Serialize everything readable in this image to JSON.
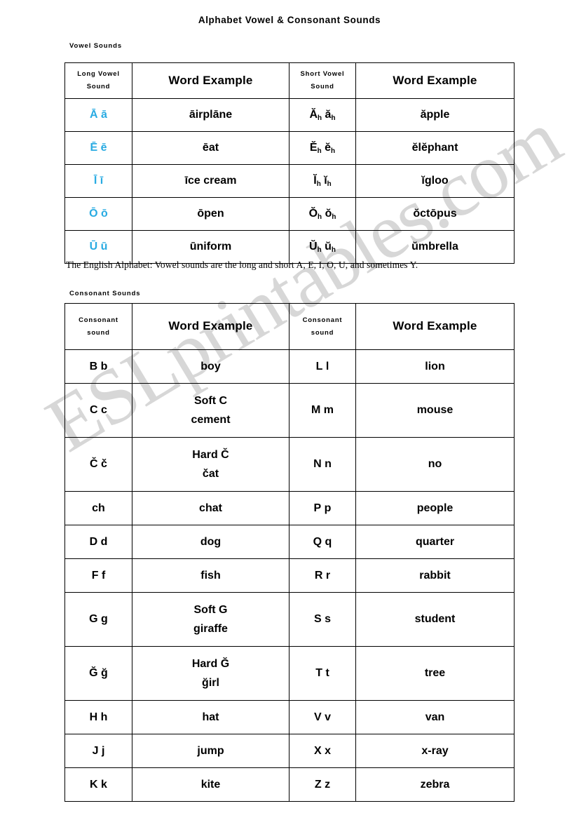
{
  "document": {
    "title": "Alphabet Vowel & Consonant Sounds",
    "watermark": "ESLprintables.com",
    "caption": "The English Alphabet: Vowel sounds are the long and short A, E, I, O, U, and sometimes Y."
  },
  "colors": {
    "long_vowel": "#29abe2",
    "short_vowel": "#7b6b9e",
    "navy": "#1b2b6b",
    "soft_consonant": "#00a24e",
    "hard_consonant": "#e01b1b",
    "dark_red": "#a01414",
    "border": "#000000",
    "watermark": "#c9c9c9"
  },
  "vowel_section": {
    "label": "Vowel Sounds",
    "headers": [
      "Long Vowel Sound",
      "Word Example",
      "Short Vowel Sound",
      "Word Example"
    ],
    "header_lines": [
      [
        "Long Vowel",
        "Sound"
      ],
      [
        "Word Example"
      ],
      [
        "Short Vowel",
        "Sound"
      ],
      [
        "Word Example"
      ]
    ],
    "rows": [
      {
        "long_sound": "Ā ā",
        "long_word": "āirplāne",
        "long_word_parts": [
          {
            "t": "ā",
            "c": "long"
          },
          {
            "t": "irpl",
            "c": "blk"
          },
          {
            "t": "ā",
            "c": "long"
          },
          {
            "t": "ne",
            "c": "blk"
          }
        ],
        "short_sound": "Ăh ăh",
        "short_sound_parts": [
          {
            "t": "Ă",
            "c": "short"
          },
          {
            "t": "h",
            "c": "short",
            "sub": true
          },
          {
            "t": " ",
            "c": "blk"
          },
          {
            "t": "ă",
            "c": "short"
          },
          {
            "t": "h",
            "c": "short",
            "sub": true
          }
        ],
        "short_word": "ăpple",
        "short_word_parts": [
          {
            "t": "ă",
            "c": "short"
          },
          {
            "t": "pple",
            "c": "blk"
          }
        ]
      },
      {
        "long_sound": "Ē ē",
        "long_word": "ēat",
        "long_word_parts": [
          {
            "t": "ē",
            "c": "long"
          },
          {
            "t": "at",
            "c": "blk"
          }
        ],
        "short_sound": "Ĕh ĕh",
        "short_sound_parts": [
          {
            "t": "Ĕ",
            "c": "short"
          },
          {
            "t": "h",
            "c": "short",
            "sub": true
          },
          {
            "t": " ",
            "c": "blk"
          },
          {
            "t": "ĕ",
            "c": "short"
          },
          {
            "t": "h",
            "c": "short",
            "sub": true
          }
        ],
        "short_word": "ĕlĕphant",
        "short_word_parts": [
          {
            "t": "ĕ",
            "c": "navy"
          },
          {
            "t": "l",
            "c": "blk"
          },
          {
            "t": "ĕ",
            "c": "short"
          },
          {
            "t": "phant",
            "c": "blk"
          }
        ]
      },
      {
        "long_sound": "Ī ī",
        "long_word": "īce cream",
        "long_word_parts": [
          {
            "t": "ī",
            "c": "long"
          },
          {
            "t": "ce cream",
            "c": "blk"
          }
        ],
        "short_sound": "Ĭh ĭh",
        "short_sound_parts": [
          {
            "t": "Ĭ",
            "c": "short"
          },
          {
            "t": "h",
            "c": "short",
            "sub": true
          },
          {
            "t": " ",
            "c": "blk"
          },
          {
            "t": "ĭ",
            "c": "short"
          },
          {
            "t": "h",
            "c": "short",
            "sub": true
          }
        ],
        "short_word": "ĭgloo",
        "short_word_parts": [
          {
            "t": "ĭ",
            "c": "short"
          },
          {
            "t": "gloo",
            "c": "blk"
          }
        ]
      },
      {
        "long_sound": "Ō ō",
        "long_word": "ōpen",
        "long_word_parts": [
          {
            "t": "ō",
            "c": "long"
          },
          {
            "t": "pen",
            "c": "blk"
          }
        ],
        "short_sound": "Ŏh ŏh",
        "short_sound_parts": [
          {
            "t": "Ŏ",
            "c": "short"
          },
          {
            "t": "h",
            "c": "short",
            "sub": true
          },
          {
            "t": " ",
            "c": "blk"
          },
          {
            "t": "ŏ",
            "c": "short"
          },
          {
            "t": "h",
            "c": "short",
            "sub": true
          }
        ],
        "short_word": "ŏctōpus",
        "short_word_parts": [
          {
            "t": "ŏ",
            "c": "short"
          },
          {
            "t": "ct",
            "c": "blk"
          },
          {
            "t": "ō",
            "c": "long"
          },
          {
            "t": "pus",
            "c": "blk"
          }
        ]
      },
      {
        "long_sound": "Ū ū",
        "long_word": "ūniform",
        "long_word_parts": [
          {
            "t": "ū",
            "c": "long"
          },
          {
            "t": "niform",
            "c": "blk"
          }
        ],
        "short_sound": "Ŭh ŭh",
        "short_sound_parts": [
          {
            "t": "Ŭ",
            "c": "short"
          },
          {
            "t": "h",
            "c": "short",
            "sub": true
          },
          {
            "t": " ",
            "c": "blk"
          },
          {
            "t": "ŭ",
            "c": "short"
          },
          {
            "t": "h",
            "c": "short",
            "sub": true
          }
        ],
        "short_word": "ŭmbrella",
        "short_word_parts": [
          {
            "t": "ŭ",
            "c": "short"
          },
          {
            "t": "mbrella",
            "c": "blk"
          }
        ]
      }
    ]
  },
  "consonant_section": {
    "label": "Consonant Sounds",
    "headers": [
      "Consonant sound",
      "Word Example",
      "Consonant sound",
      "Word Example"
    ],
    "header_lines": [
      [
        "Consonant",
        "sound"
      ],
      [
        "Word Example"
      ],
      [
        "Consonant",
        "sound"
      ],
      [
        "Word Example"
      ]
    ],
    "rows": [
      {
        "tall": false,
        "left_sound": "B b",
        "left_sound_parts": [
          {
            "t": "B b",
            "c": "blk"
          }
        ],
        "left_word": "boy",
        "left_word_lines": [
          [
            {
              "t": "boy",
              "c": "blk"
            }
          ]
        ],
        "right_sound": "L l",
        "right_sound_parts": [
          {
            "t": "L l",
            "c": "blk"
          }
        ],
        "right_word": "lion"
      },
      {
        "tall": true,
        "left_sound": "C c",
        "left_sound_parts": [
          {
            "t": "C c",
            "c": "soft"
          }
        ],
        "left_word": "Soft C cement",
        "left_word_lines": [
          [
            {
              "t": "Soft ",
              "c": "blk"
            },
            {
              "t": "C",
              "c": "soft"
            }
          ],
          [
            {
              "t": "c",
              "c": "soft"
            },
            {
              "t": "ement",
              "c": "blk"
            }
          ]
        ],
        "right_sound": "M m",
        "right_sound_parts": [
          {
            "t": "M m",
            "c": "blk"
          }
        ],
        "right_word": "mouse"
      },
      {
        "tall": true,
        "left_sound": "Č č",
        "left_sound_parts": [
          {
            "t": "Č č",
            "c": "hard"
          }
        ],
        "left_word": "Hard Č čat",
        "left_word_lines": [
          [
            {
              "t": "Hard ",
              "c": "blk"
            },
            {
              "t": "Č",
              "c": "hard"
            }
          ],
          [
            {
              "t": "č",
              "c": "hard"
            },
            {
              "t": "at",
              "c": "blk"
            }
          ]
        ],
        "right_sound": "N n",
        "right_sound_parts": [
          {
            "t": "N n",
            "c": "blk"
          }
        ],
        "right_word": "no"
      },
      {
        "tall": false,
        "left_sound": "ch",
        "left_sound_parts": [
          {
            "t": "ch",
            "c": "dkred"
          }
        ],
        "left_word": "chat",
        "left_word_lines": [
          [
            {
              "t": "ch",
              "c": "dkred"
            },
            {
              "t": "at",
              "c": "blk"
            }
          ]
        ],
        "right_sound": "P p",
        "right_sound_parts": [
          {
            "t": "P p",
            "c": "blk"
          }
        ],
        "right_word": "people"
      },
      {
        "tall": false,
        "left_sound": "D d",
        "left_sound_parts": [
          {
            "t": "D d",
            "c": "blk"
          }
        ],
        "left_word": "dog",
        "left_word_lines": [
          [
            {
              "t": "dog",
              "c": "blk"
            }
          ]
        ],
        "right_sound": "Q q",
        "right_sound_parts": [
          {
            "t": "Q q",
            "c": "blk"
          }
        ],
        "right_word": "quarter"
      },
      {
        "tall": false,
        "left_sound": "F f",
        "left_sound_parts": [
          {
            "t": "F f",
            "c": "blk"
          }
        ],
        "left_word": "fish",
        "left_word_lines": [
          [
            {
              "t": "fish",
              "c": "blk"
            }
          ]
        ],
        "right_sound": "R r",
        "right_sound_parts": [
          {
            "t": "R r",
            "c": "blk"
          }
        ],
        "right_word": "rabbit"
      },
      {
        "tall": true,
        "left_sound": "G g",
        "left_sound_parts": [
          {
            "t": "G g",
            "c": "soft"
          }
        ],
        "left_word": "Soft G giraffe",
        "left_word_lines": [
          [
            {
              "t": "Soft ",
              "c": "blk"
            },
            {
              "t": "G",
              "c": "soft"
            }
          ],
          [
            {
              "t": "g",
              "c": "soft"
            },
            {
              "t": "iraffe",
              "c": "blk"
            }
          ]
        ],
        "right_sound": "S s",
        "right_sound_parts": [
          {
            "t": "S s",
            "c": "blk"
          }
        ],
        "right_word": "student"
      },
      {
        "tall": true,
        "left_sound": "Ğ ğ",
        "left_sound_parts": [
          {
            "t": "Ğ ğ",
            "c": "hard"
          }
        ],
        "left_word": "Hard Ğ ğirl",
        "left_word_lines": [
          [
            {
              "t": "Hard ",
              "c": "blk"
            },
            {
              "t": "Ğ",
              "c": "hard"
            }
          ],
          [
            {
              "t": "ğ",
              "c": "hard"
            },
            {
              "t": "irl",
              "c": "blk"
            }
          ]
        ],
        "right_sound": "T t",
        "right_sound_parts": [
          {
            "t": "T t",
            "c": "blk"
          }
        ],
        "right_word": "tree"
      },
      {
        "tall": false,
        "left_sound": "H h",
        "left_sound_parts": [
          {
            "t": "H h",
            "c": "blk"
          }
        ],
        "left_word": "hat",
        "left_word_lines": [
          [
            {
              "t": "hat",
              "c": "blk"
            }
          ]
        ],
        "right_sound": "V v",
        "right_sound_parts": [
          {
            "t": "V v",
            "c": "blk"
          }
        ],
        "right_word": "van"
      },
      {
        "tall": false,
        "left_sound": "J j",
        "left_sound_parts": [
          {
            "t": "J j",
            "c": "blk"
          }
        ],
        "left_word": "jump",
        "left_word_lines": [
          [
            {
              "t": "jump",
              "c": "blk"
            }
          ]
        ],
        "right_sound": "X x",
        "right_sound_parts": [
          {
            "t": "X x",
            "c": "blk"
          }
        ],
        "right_word": "x-ray"
      },
      {
        "tall": false,
        "left_sound": "K k",
        "left_sound_parts": [
          {
            "t": "K k",
            "c": "blk"
          }
        ],
        "left_word": "kite",
        "left_word_lines": [
          [
            {
              "t": "kite",
              "c": "blk"
            }
          ]
        ],
        "right_sound": "Z z",
        "right_sound_parts": [
          {
            "t": "Z z",
            "c": "blk"
          }
        ],
        "right_word": "zebra"
      }
    ]
  }
}
